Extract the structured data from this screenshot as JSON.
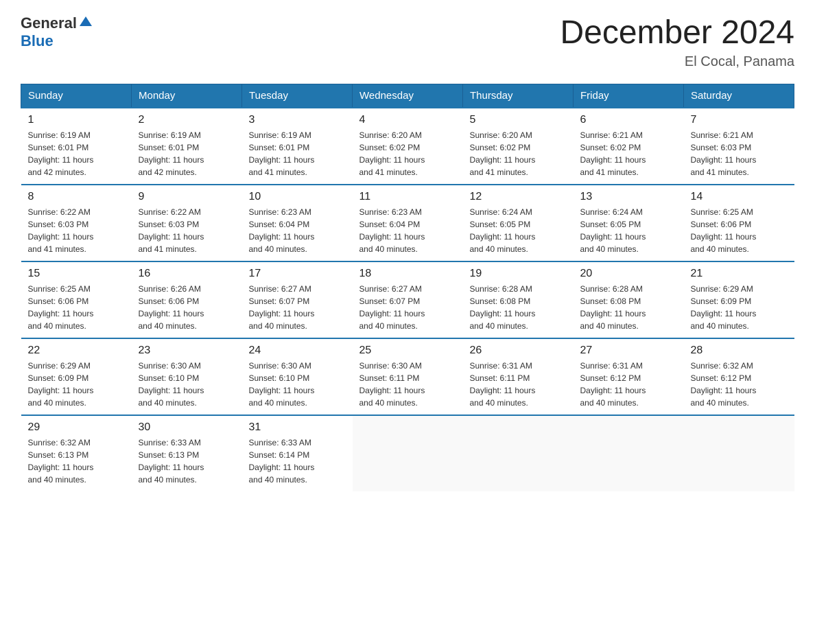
{
  "header": {
    "logo_general": "General",
    "logo_blue": "Blue",
    "month_title": "December 2024",
    "location": "El Cocal, Panama"
  },
  "days_of_week": [
    "Sunday",
    "Monday",
    "Tuesday",
    "Wednesday",
    "Thursday",
    "Friday",
    "Saturday"
  ],
  "weeks": [
    [
      {
        "day": "1",
        "sunrise": "6:19 AM",
        "sunset": "6:01 PM",
        "daylight": "11 hours and 42 minutes."
      },
      {
        "day": "2",
        "sunrise": "6:19 AM",
        "sunset": "6:01 PM",
        "daylight": "11 hours and 42 minutes."
      },
      {
        "day": "3",
        "sunrise": "6:19 AM",
        "sunset": "6:01 PM",
        "daylight": "11 hours and 41 minutes."
      },
      {
        "day": "4",
        "sunrise": "6:20 AM",
        "sunset": "6:02 PM",
        "daylight": "11 hours and 41 minutes."
      },
      {
        "day": "5",
        "sunrise": "6:20 AM",
        "sunset": "6:02 PM",
        "daylight": "11 hours and 41 minutes."
      },
      {
        "day": "6",
        "sunrise": "6:21 AM",
        "sunset": "6:02 PM",
        "daylight": "11 hours and 41 minutes."
      },
      {
        "day": "7",
        "sunrise": "6:21 AM",
        "sunset": "6:03 PM",
        "daylight": "11 hours and 41 minutes."
      }
    ],
    [
      {
        "day": "8",
        "sunrise": "6:22 AM",
        "sunset": "6:03 PM",
        "daylight": "11 hours and 41 minutes."
      },
      {
        "day": "9",
        "sunrise": "6:22 AM",
        "sunset": "6:03 PM",
        "daylight": "11 hours and 41 minutes."
      },
      {
        "day": "10",
        "sunrise": "6:23 AM",
        "sunset": "6:04 PM",
        "daylight": "11 hours and 40 minutes."
      },
      {
        "day": "11",
        "sunrise": "6:23 AM",
        "sunset": "6:04 PM",
        "daylight": "11 hours and 40 minutes."
      },
      {
        "day": "12",
        "sunrise": "6:24 AM",
        "sunset": "6:05 PM",
        "daylight": "11 hours and 40 minutes."
      },
      {
        "day": "13",
        "sunrise": "6:24 AM",
        "sunset": "6:05 PM",
        "daylight": "11 hours and 40 minutes."
      },
      {
        "day": "14",
        "sunrise": "6:25 AM",
        "sunset": "6:06 PM",
        "daylight": "11 hours and 40 minutes."
      }
    ],
    [
      {
        "day": "15",
        "sunrise": "6:25 AM",
        "sunset": "6:06 PM",
        "daylight": "11 hours and 40 minutes."
      },
      {
        "day": "16",
        "sunrise": "6:26 AM",
        "sunset": "6:06 PM",
        "daylight": "11 hours and 40 minutes."
      },
      {
        "day": "17",
        "sunrise": "6:27 AM",
        "sunset": "6:07 PM",
        "daylight": "11 hours and 40 minutes."
      },
      {
        "day": "18",
        "sunrise": "6:27 AM",
        "sunset": "6:07 PM",
        "daylight": "11 hours and 40 minutes."
      },
      {
        "day": "19",
        "sunrise": "6:28 AM",
        "sunset": "6:08 PM",
        "daylight": "11 hours and 40 minutes."
      },
      {
        "day": "20",
        "sunrise": "6:28 AM",
        "sunset": "6:08 PM",
        "daylight": "11 hours and 40 minutes."
      },
      {
        "day": "21",
        "sunrise": "6:29 AM",
        "sunset": "6:09 PM",
        "daylight": "11 hours and 40 minutes."
      }
    ],
    [
      {
        "day": "22",
        "sunrise": "6:29 AM",
        "sunset": "6:09 PM",
        "daylight": "11 hours and 40 minutes."
      },
      {
        "day": "23",
        "sunrise": "6:30 AM",
        "sunset": "6:10 PM",
        "daylight": "11 hours and 40 minutes."
      },
      {
        "day": "24",
        "sunrise": "6:30 AM",
        "sunset": "6:10 PM",
        "daylight": "11 hours and 40 minutes."
      },
      {
        "day": "25",
        "sunrise": "6:30 AM",
        "sunset": "6:11 PM",
        "daylight": "11 hours and 40 minutes."
      },
      {
        "day": "26",
        "sunrise": "6:31 AM",
        "sunset": "6:11 PM",
        "daylight": "11 hours and 40 minutes."
      },
      {
        "day": "27",
        "sunrise": "6:31 AM",
        "sunset": "6:12 PM",
        "daylight": "11 hours and 40 minutes."
      },
      {
        "day": "28",
        "sunrise": "6:32 AM",
        "sunset": "6:12 PM",
        "daylight": "11 hours and 40 minutes."
      }
    ],
    [
      {
        "day": "29",
        "sunrise": "6:32 AM",
        "sunset": "6:13 PM",
        "daylight": "11 hours and 40 minutes."
      },
      {
        "day": "30",
        "sunrise": "6:33 AM",
        "sunset": "6:13 PM",
        "daylight": "11 hours and 40 minutes."
      },
      {
        "day": "31",
        "sunrise": "6:33 AM",
        "sunset": "6:14 PM",
        "daylight": "11 hours and 40 minutes."
      },
      null,
      null,
      null,
      null
    ]
  ],
  "labels": {
    "sunrise": "Sunrise:",
    "sunset": "Sunset:",
    "daylight": "Daylight:"
  }
}
